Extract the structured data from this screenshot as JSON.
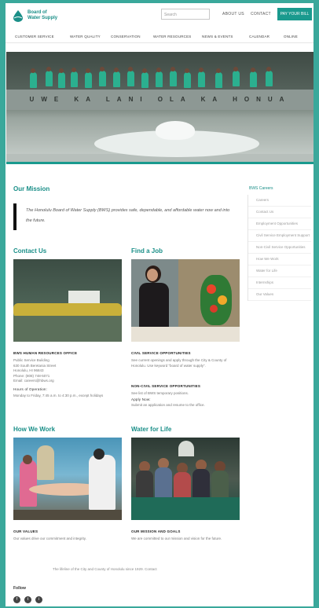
{
  "header": {
    "logo_line1": "Board of",
    "logo_line2": "Water Supply",
    "search_placeholder": "Search",
    "links": [
      "ABOUT US",
      "CONTACT"
    ],
    "pay_button": "PAY YOUR BILL"
  },
  "nav": [
    "CUSTOMER SERVICE",
    "WATER QUALITY",
    "CONSERVATION",
    "WATER RESOURCES",
    "NEWS & EVENTS",
    "CALENDAR",
    "ONLINE"
  ],
  "hero": {
    "inscription": "UWE KA LANI OLA KA HONUA"
  },
  "mission": {
    "title": "Our Mission",
    "text": "The Honolulu Board of Water Supply (BWS) provides safe, dependable, and affordable water now and into the future."
  },
  "sidebar": {
    "title": "BWS Careers",
    "items": [
      "Careers",
      "Contact Us",
      "Employment Opportunities",
      "Civil Service Employment Support",
      "Non-Civil Service Opportunities",
      "How We Work",
      "Water for Life",
      "Internships",
      "Our Values"
    ]
  },
  "contact": {
    "title": "Contact Us",
    "office": "BWS HUMAN RESOURCES OFFICE",
    "address": [
      "Public Service Building",
      "630 South Beretania Street",
      "Honolulu, HI 96843",
      "Phone: (808) 748-5071",
      "Email: careers@hbws.org"
    ],
    "hours_label": "Hours of Operation:",
    "hours": "Monday to Friday, 7:45 a.m. to 4:30 p.m., except holidays"
  },
  "job": {
    "title": "Find a Job",
    "civil_label": "CIVIL SERVICE OPPORTUNITIES",
    "civil_text": "See current openings and apply through the City & County of Honolulu. Use keyword “board of water supply”.",
    "noncivil_label": "NON-CIVIL SERVICE OPPORTUNITIES",
    "noncivil_text": "See list of BWS temporary positions.",
    "apply_label": "Apply Now:",
    "apply_text": "Submit an application and resume to the office."
  },
  "how": {
    "title": "How We Work",
    "label": "OUR VALUES",
    "text": "Our values drive our commitment and integrity."
  },
  "water": {
    "title": "Water for Life",
    "label": "OUR MISSION AND GOALS",
    "text": "We are committed to our mission and vision for the future."
  },
  "footer": {
    "note": "The lifeline of the City and County of Honolulu since 1929. Contact",
    "follow": "Follow",
    "social_icons": [
      "f",
      "t",
      "i"
    ]
  },
  "colors": {
    "teal": "#1a9a8e",
    "heading": "#1a8f88",
    "background": "#3aa89b"
  }
}
